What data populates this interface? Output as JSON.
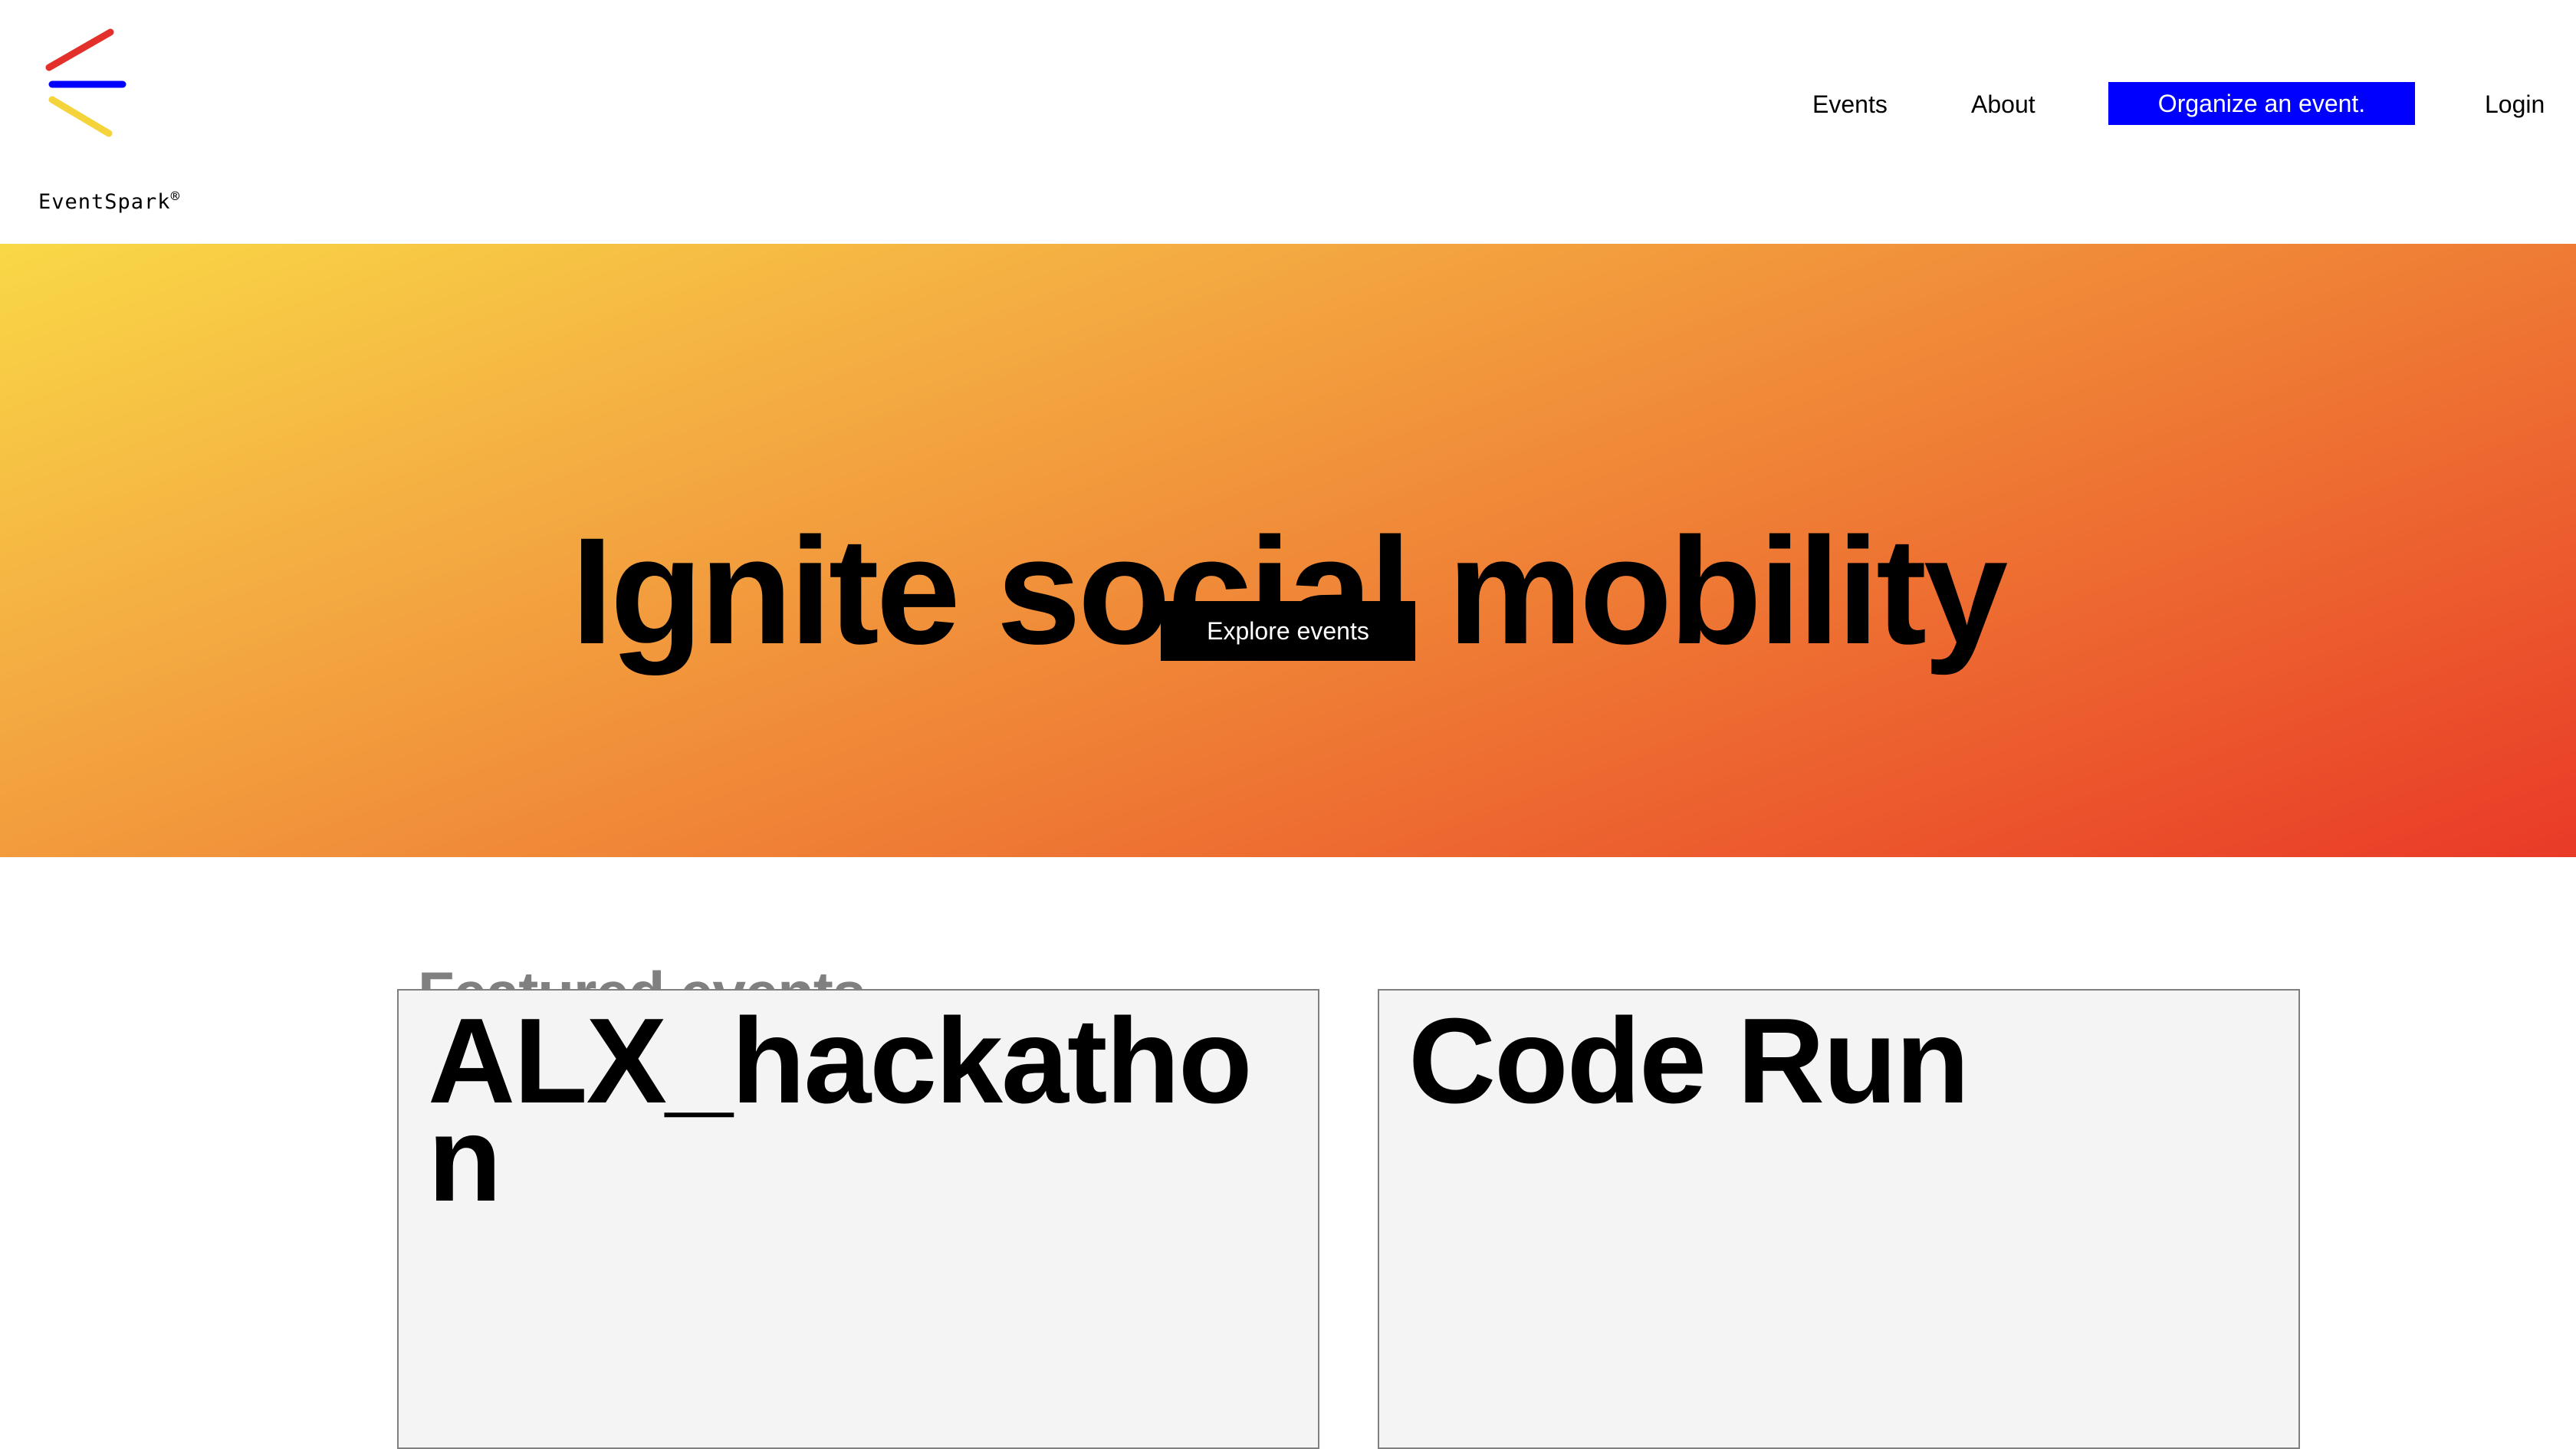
{
  "brand": {
    "name": "EventSpark",
    "registered_mark": "®",
    "logo_icon": "lines-logo-icon",
    "logo_colors": [
      "#e3302a",
      "#0000ff",
      "#f5d33a"
    ]
  },
  "nav": {
    "events_label": "Events",
    "about_label": "About",
    "cta_label": "Organize an event.",
    "login_label": "Login"
  },
  "hero": {
    "title": "Ignite social mobility",
    "button_label": "Explore events",
    "gradient_colors": [
      "#f9d846",
      "#f4ad42",
      "#ef7f35",
      "#e93a27"
    ]
  },
  "featured": {
    "heading": "Featured events",
    "events": [
      {
        "title": "ALX_hackathon"
      },
      {
        "title": "Code Run"
      }
    ]
  },
  "colors": {
    "accent": "#0000ff",
    "button_dark": "#000000",
    "card_bg": "#f4f4f4",
    "muted_text": "#808080"
  }
}
